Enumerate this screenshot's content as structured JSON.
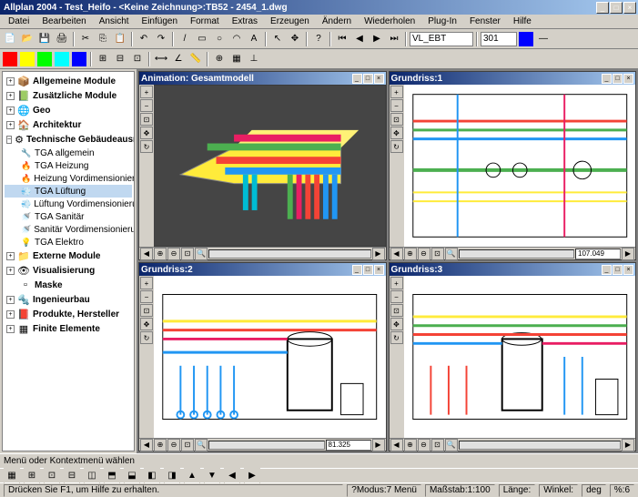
{
  "title": "Allplan 2004 - Test_Heifo - <Keine Zeichnung>:TB52 - 2454_1.dwg",
  "menu": [
    "Datei",
    "Bearbeiten",
    "Ansicht",
    "Einfügen",
    "Format",
    "Extras",
    "Erzeugen",
    "Ändern",
    "Wiederholen",
    "Plug-In",
    "Fenster",
    "Hilfe"
  ],
  "toolbar2_input1": "VL_EBT",
  "toolbar2_input2": "301",
  "tree": {
    "items": [
      {
        "label": "Allgemeine Module",
        "icon": "📦",
        "bold": true,
        "expand": "+"
      },
      {
        "label": "Zusätzliche Module",
        "icon": "📗",
        "bold": true,
        "expand": "+"
      },
      {
        "label": "Geo",
        "icon": "🌐",
        "bold": true,
        "expand": "+"
      },
      {
        "label": "Architektur",
        "icon": "🏠",
        "bold": true,
        "expand": "+"
      },
      {
        "label": "Technische Gebäudeausrüstung",
        "icon": "⚙",
        "bold": true,
        "expand": "−"
      },
      {
        "label": "TGA allgemein",
        "icon": "🔧",
        "sub": true
      },
      {
        "label": "TGA Heizung",
        "icon": "🔥",
        "sub": true
      },
      {
        "label": "Heizung Vordimensionierung",
        "icon": "🔥",
        "sub": true
      },
      {
        "label": "TGA Lüftung",
        "icon": "💨",
        "sub": true,
        "selected": true
      },
      {
        "label": "Lüftung Vordimensionierung",
        "icon": "💨",
        "sub": true
      },
      {
        "label": "TGA Sanitär",
        "icon": "🚿",
        "sub": true
      },
      {
        "label": "Sanitär Vordimensionierung",
        "icon": "🚿",
        "sub": true
      },
      {
        "label": "TGA Elektro",
        "icon": "💡",
        "sub": true
      },
      {
        "label": "Externe Module",
        "icon": "📁",
        "bold": true,
        "expand": "+"
      },
      {
        "label": "Visualisierung",
        "icon": "👁",
        "bold": true,
        "expand": "+"
      },
      {
        "label": "Maske",
        "icon": "▫",
        "bold": true
      },
      {
        "label": "Ingenieurbau",
        "icon": "🔩",
        "bold": true,
        "expand": "+"
      },
      {
        "label": "Produkte, Hersteller",
        "icon": "📕",
        "bold": true,
        "expand": "+"
      },
      {
        "label": "Finite Elemente",
        "icon": "▦",
        "bold": true,
        "expand": "+"
      }
    ]
  },
  "menu_hint": "Menü oder Kontextmenü wählen",
  "viewports": [
    {
      "title": "Animation: Gesamtmodell",
      "dark": true,
      "coord": ""
    },
    {
      "title": "Grundriss:1",
      "coord": "107.049"
    },
    {
      "title": "Grundriss:2",
      "coord": "81.325"
    },
    {
      "title": "Grundriss:3",
      "coord": ""
    }
  ],
  "status": {
    "help": "Drücken Sie F1, um Hilfe zu erhalten.",
    "modus_label": "Modus:",
    "modus": "7 Menü",
    "massstab_label": "Maßstab:",
    "massstab": "1:100",
    "laenge_label": "Länge:",
    "laenge": "",
    "winkel_label": "Winkel:",
    "winkel": "",
    "deg": "deg",
    "pct_label": "%:",
    "pct": "6"
  }
}
